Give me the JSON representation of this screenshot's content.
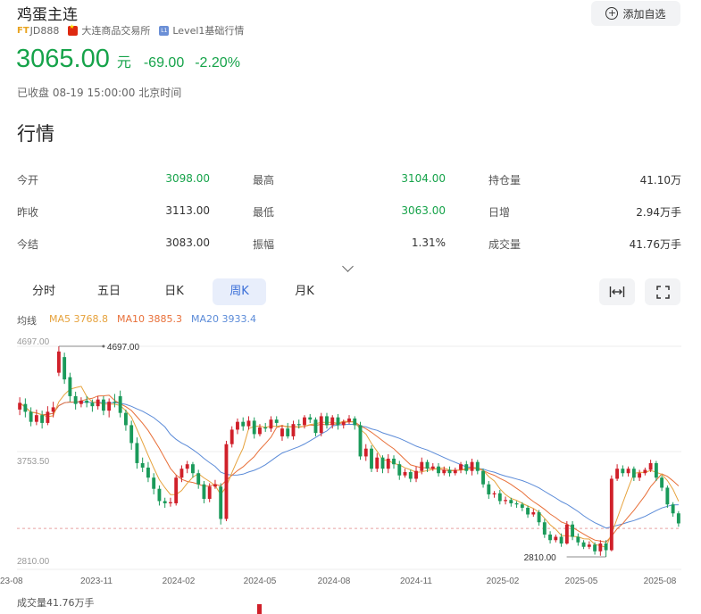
{
  "header": {
    "title": "鸡蛋主连",
    "code_prefix": "FT",
    "code": "JD888",
    "exchange": "大连商品交易所",
    "level_badge": "L1",
    "quote_level": "Level1基础行情",
    "watch_button_icon": "plus-circle-icon",
    "watch_button": "添加自选"
  },
  "quote": {
    "price": "3065.00",
    "unit": "元",
    "change": "-69.00",
    "change_pct": "-2.20%",
    "close_time": "已收盘 08-19 15:00:00 北京时间",
    "color": "#16a34a"
  },
  "market": {
    "title": "行情",
    "rows": [
      [
        [
          "今开",
          "3098.00"
        ],
        [
          "最高",
          "3104.00"
        ],
        [
          "持仓量",
          "41.10万"
        ]
      ],
      [
        [
          "昨收",
          "3113.00"
        ],
        [
          "最低",
          "3063.00"
        ],
        [
          "日增",
          "2.94万手"
        ]
      ],
      [
        [
          "今结",
          "3083.00"
        ],
        [
          "振幅",
          "1.31%"
        ],
        [
          "成交量",
          "41.76万手"
        ]
      ]
    ]
  },
  "tabs": [
    "分时",
    "五日",
    "日K",
    "周K",
    "月K"
  ],
  "active_tab": "周K",
  "tools": {
    "fit_icon": "fit-width-icon",
    "fullscreen_icon": "fullscreen-icon"
  },
  "ma": {
    "label": "均线",
    "ma5": "MA5 3768.8",
    "ma10": "MA10 3885.3",
    "ma20": "MA20 3933.4",
    "colors": {
      "ma5": "#e6a23c",
      "ma10": "#e8703a",
      "ma20": "#5b8bd8"
    }
  },
  "chart_data": {
    "type": "candlestick",
    "y_ticks": [
      "4697.00",
      "3753.50",
      "2810.00"
    ],
    "y_range": [
      2810,
      4697
    ],
    "x_ticks": [
      "23-08",
      "2023-11",
      "2024-02",
      "2024-05",
      "2024-08",
      "2024-11",
      "2025-02",
      "2025-05",
      "2025-08"
    ],
    "max_annotation": "4697.00",
    "min_annotation": "2810.00",
    "last_close": 3065,
    "up_color": "#d0202a",
    "down_color": "#1a9a5a",
    "candles": [
      [
        4130,
        4190,
        4080,
        4240
      ],
      [
        4180,
        4110,
        4060,
        4230
      ],
      [
        4110,
        4020,
        3980,
        4150
      ],
      [
        4020,
        4080,
        3990,
        4130
      ],
      [
        4080,
        4010,
        3960,
        4120
      ],
      [
        4010,
        4110,
        3990,
        4160
      ],
      [
        4110,
        4150,
        4060,
        4200
      ],
      [
        4460,
        4650,
        4430,
        4697
      ],
      [
        4600,
        4400,
        4360,
        4640
      ],
      [
        4420,
        4250,
        4200,
        4460
      ],
      [
        4250,
        4180,
        4130,
        4290
      ],
      [
        4180,
        4210,
        4150,
        4240
      ],
      [
        4210,
        4190,
        4150,
        4250
      ],
      [
        4190,
        4160,
        4110,
        4220
      ],
      [
        4160,
        4220,
        4130,
        4250
      ],
      [
        4220,
        4120,
        4080,
        4250
      ],
      [
        4120,
        4200,
        4060,
        4230
      ],
      [
        4200,
        4190,
        4150,
        4270
      ],
      [
        4250,
        4100,
        4060,
        4300
      ],
      [
        4100,
        3990,
        3940,
        4130
      ],
      [
        3990,
        3830,
        3770,
        4030
      ],
      [
        3830,
        3650,
        3600,
        3880
      ],
      [
        3650,
        3610,
        3570,
        3700
      ],
      [
        3610,
        3520,
        3480,
        3660
      ],
      [
        3520,
        3420,
        3370,
        3560
      ],
      [
        3420,
        3310,
        3270,
        3450
      ],
      [
        3310,
        3290,
        3250,
        3340
      ],
      [
        3290,
        3300,
        3260,
        3340
      ],
      [
        3290,
        3520,
        3270,
        3540
      ],
      [
        3520,
        3600,
        3480,
        3630
      ],
      [
        3600,
        3640,
        3560,
        3670
      ],
      [
        3640,
        3560,
        3520,
        3660
      ],
      [
        3560,
        3460,
        3420,
        3590
      ],
      [
        3460,
        3330,
        3290,
        3490
      ],
      [
        3330,
        3440,
        3300,
        3470
      ],
      [
        3440,
        3460,
        3420,
        3500
      ],
      [
        3440,
        3150,
        3100,
        3470
      ],
      [
        3150,
        3820,
        3130,
        3850
      ],
      [
        3820,
        3950,
        3790,
        3980
      ],
      [
        3950,
        4020,
        3910,
        4050
      ],
      [
        4020,
        3980,
        3940,
        4060
      ],
      [
        3980,
        4030,
        3950,
        4070
      ],
      [
        4030,
        3910,
        3870,
        4060
      ],
      [
        3910,
        3970,
        3890,
        4000
      ],
      [
        3970,
        3960,
        3930,
        4010
      ],
      [
        3960,
        4040,
        3930,
        4070
      ],
      [
        4040,
        4010,
        3980,
        4070
      ],
      [
        3890,
        3960,
        3850,
        3990
      ],
      [
        3960,
        3890,
        3870,
        4010
      ],
      [
        3890,
        4000,
        3860,
        4030
      ],
      [
        4000,
        3990,
        3960,
        4040
      ],
      [
        3990,
        4060,
        3960,
        4080
      ],
      [
        4060,
        4040,
        4010,
        4090
      ],
      [
        4040,
        3920,
        3890,
        4060
      ],
      [
        3920,
        4070,
        3890,
        4100
      ],
      [
        4070,
        3990,
        3960,
        4100
      ],
      [
        3990,
        4060,
        3960,
        4080
      ],
      [
        4060,
        3990,
        3950,
        4090
      ],
      [
        3990,
        4020,
        3960,
        4040
      ],
      [
        4020,
        4050,
        4000,
        4080
      ],
      [
        4050,
        3990,
        3950,
        4070
      ],
      [
        3990,
        3710,
        3680,
        4020
      ],
      [
        3710,
        3780,
        3670,
        3820
      ],
      [
        3780,
        3600,
        3570,
        3810
      ],
      [
        3600,
        3700,
        3570,
        3740
      ],
      [
        3700,
        3600,
        3560,
        3720
      ],
      [
        3600,
        3690,
        3560,
        3730
      ],
      [
        3690,
        3640,
        3600,
        3720
      ],
      [
        3640,
        3540,
        3500,
        3670
      ],
      [
        3540,
        3570,
        3520,
        3600
      ],
      [
        3570,
        3510,
        3480,
        3590
      ],
      [
        3510,
        3580,
        3480,
        3620
      ],
      [
        3580,
        3660,
        3550,
        3700
      ],
      [
        3660,
        3600,
        3570,
        3680
      ],
      [
        3600,
        3620,
        3580,
        3650
      ],
      [
        3620,
        3560,
        3530,
        3650
      ],
      [
        3560,
        3590,
        3540,
        3620
      ],
      [
        3590,
        3560,
        3530,
        3620
      ],
      [
        3560,
        3590,
        3540,
        3610
      ],
      [
        3590,
        3640,
        3560,
        3660
      ],
      [
        3640,
        3580,
        3550,
        3670
      ],
      [
        3580,
        3660,
        3540,
        3690
      ],
      [
        3660,
        3580,
        3550,
        3680
      ],
      [
        3580,
        3460,
        3430,
        3600
      ],
      [
        3460,
        3370,
        3330,
        3490
      ],
      [
        3370,
        3380,
        3340,
        3400
      ],
      [
        3380,
        3310,
        3280,
        3410
      ],
      [
        3310,
        3320,
        3280,
        3350
      ],
      [
        3320,
        3290,
        3260,
        3340
      ],
      [
        3290,
        3280,
        3250,
        3310
      ],
      [
        3280,
        3250,
        3220,
        3300
      ],
      [
        3250,
        3190,
        3160,
        3270
      ],
      [
        3190,
        3210,
        3170,
        3240
      ],
      [
        3210,
        3120,
        3090,
        3230
      ],
      [
        3120,
        3010,
        2980,
        3150
      ],
      [
        3010,
        2960,
        2930,
        3040
      ],
      [
        2960,
        2990,
        2940,
        3010
      ],
      [
        2990,
        2930,
        2900,
        3020
      ],
      [
        2930,
        3100,
        2920,
        3130
      ],
      [
        3100,
        2990,
        2960,
        3130
      ],
      [
        2990,
        2940,
        2910,
        3020
      ],
      [
        2940,
        2900,
        2880,
        2960
      ],
      [
        2900,
        2920,
        2880,
        2950
      ],
      [
        2920,
        2860,
        2830,
        2940
      ],
      [
        2860,
        2930,
        2820,
        2960
      ],
      [
        2930,
        2870,
        2810,
        2960
      ],
      [
        2870,
        3510,
        2860,
        3540
      ],
      [
        3510,
        3600,
        3490,
        3640
      ],
      [
        3600,
        3560,
        3530,
        3630
      ],
      [
        3560,
        3600,
        3530,
        3620
      ],
      [
        3600,
        3520,
        3490,
        3620
      ],
      [
        3520,
        3560,
        3490,
        3590
      ],
      [
        3560,
        3590,
        3540,
        3610
      ],
      [
        3590,
        3650,
        3570,
        3680
      ],
      [
        3650,
        3520,
        3490,
        3670
      ],
      [
        3520,
        3430,
        3400,
        3540
      ],
      [
        3430,
        3280,
        3250,
        3450
      ],
      [
        3280,
        3200,
        3170,
        3300
      ],
      [
        3200,
        3110,
        3080,
        3220
      ]
    ]
  },
  "volume_label": "成交量41.76万手"
}
